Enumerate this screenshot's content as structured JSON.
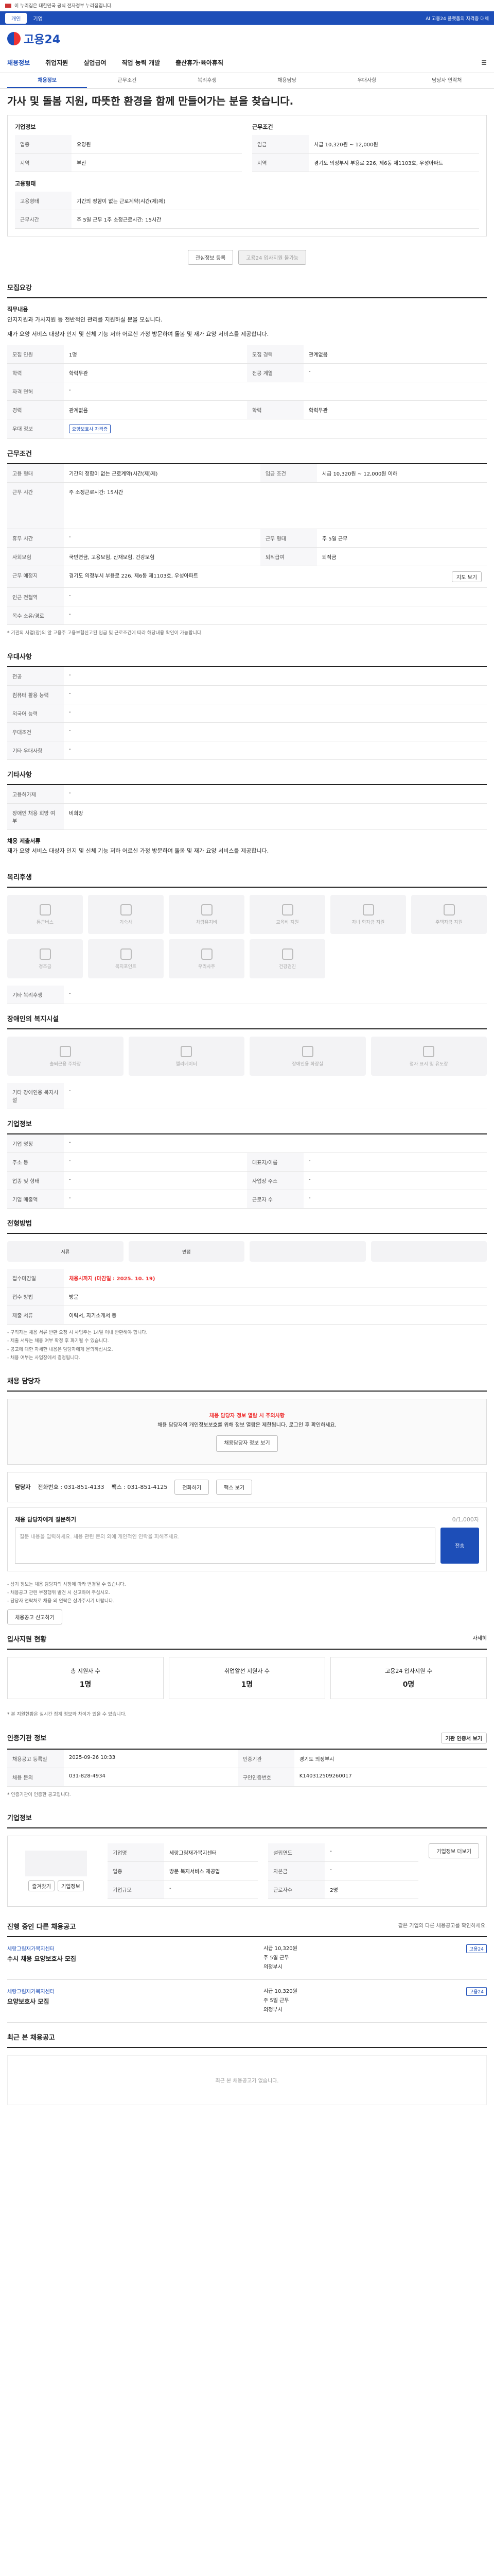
{
  "topbar": {
    "notice": "이 누리집은 대한민국 공식 전자정부 누리집입니다."
  },
  "subbar": {
    "tabs": [
      "개인",
      "기업"
    ],
    "right": "AI 고용24 플랫폼의 자격증 대체"
  },
  "header": {
    "logo_text": "고용24"
  },
  "gnb": {
    "items": [
      "채용정보",
      "취업지원",
      "실업급여",
      "직업 능력 개발",
      "출산휴가·육아휴직"
    ],
    "right": "☰"
  },
  "subtabs": [
    "채용정보",
    "근무조건",
    "복리후생",
    "채용담당",
    "우대사항",
    "담당자 연락처"
  ],
  "job": {
    "banner_title": "가사 및 돌봄 지원, 따뜻한 환경을 함께 만들어가는 분을 찾습니다.",
    "company_label": "기업정보",
    "salary_label": "근무조건",
    "rows_left": [
      {
        "k": "업종",
        "v": "요양원"
      },
      {
        "k": "지역",
        "v": "부산"
      }
    ],
    "rows_right": [
      {
        "k": "임금",
        "v": "시급 10,320원 ~ 12,000원"
      },
      {
        "k": "지역",
        "v": "경기도 의정부시 부용로 226, 제6동 제1103호, 우성아파트"
      }
    ],
    "hire_label": "고용형태",
    "hire_rows": [
      {
        "k": "고용형태",
        "v": "기간의 정함이 없는 근로계약(시간(제)제)"
      },
      {
        "k": "근무시간",
        "v": "주 5일 근무 1주 소정근로시간: 15시간"
      }
    ],
    "btn_bookmark": "관심정보 등록",
    "btn_apply": "고용24 입사지원 불가능"
  },
  "recruit": {
    "title": "모집요강",
    "intro": "직무내용",
    "intro_text": "인지지원과 가사지원 등 전반적인 관리를 지원하실 분을 모십니다.",
    "detail_text": "재가 요양 서비스 대상자 인지 및 신체 기능 저하 어르신 가정 방문하여 돌봄 및 재가 요양 서비스를 제공합니다.",
    "rows": [
      {
        "k": "모집 인원",
        "v": "1명",
        "k2": "모집 경력",
        "v2": "관계없음"
      },
      {
        "k": "학력",
        "v": "학력무관",
        "k2": "전공 계열",
        "v2": "-"
      },
      {
        "k": "자격 면허",
        "v": "-",
        "k2": "",
        "v2": ""
      },
      {
        "k": "경력",
        "v": "관계없음",
        "k2": "학력",
        "v2": "학력무관"
      },
      {
        "k": "우대 정보",
        "v": "요양보호사 자격증",
        "k2": "",
        "v2": ""
      }
    ]
  },
  "conditions": {
    "title": "근무조건",
    "rows": [
      {
        "k": "고용 형태",
        "v": "기간의 정함이 없는 근로계약(시간(제)제)",
        "k2": "임금 조건",
        "v2": "시급 10,320원 ~ 12,000원 이하"
      },
      {
        "k": "근무 시간",
        "v": "주 소정근로시간: 15시간",
        "k2": "",
        "v2": ""
      },
      {
        "k": "휴무 시간",
        "v": "-",
        "k2": "근무 형태",
        "v2": "주 5일 근무"
      },
      {
        "k": "사회보험",
        "v": "국민연금, 고용보험, 산재보험, 건강보험",
        "k2": "퇴직급여",
        "v2": "퇴직금"
      },
      {
        "k": "근무 예정지",
        "v": "경기도 의정부시 부용로 226, 제6동 제1103호, 우성아파트",
        "k2": "",
        "v2": ""
      },
      {
        "k": "인근 전철역",
        "v": "-",
        "k2": "",
        "v2": ""
      },
      {
        "k": "목수 소유/경로",
        "v": "-",
        "k2": "",
        "v2": ""
      }
    ],
    "map_btn": "지도 보기",
    "footnote": "* 기관의 사업(장)의 앞 고용주 고용보험신고된 임금 및 근로조건에 따라 해당내용 확인이 가능합니다."
  },
  "preference": {
    "title": "우대사항",
    "rows": [
      {
        "k": "전공",
        "v": "-"
      },
      {
        "k": "컴퓨터 활용 능력",
        "v": "-"
      },
      {
        "k": "외국어 능력",
        "v": "-"
      },
      {
        "k": "우대조건",
        "v": "-"
      },
      {
        "k": "기타 우대사항",
        "v": "-"
      }
    ]
  },
  "etc": {
    "title": "기타사항",
    "rows": [
      {
        "k": "고용허가제",
        "v": "-"
      },
      {
        "k": "장애인 채용 희망 여부",
        "v": "비희망"
      }
    ],
    "extra_title": "채용 제출서류",
    "extra_text": "재가 요양 서비스 대상자 인지 및 신체 기능 저하 어르신 가정 방문하여 돌봄 및 재가 요양 서비스를 제공합니다."
  },
  "welfare": {
    "title": "복리후생",
    "items": [
      "통근버스",
      "기숙사",
      "차량유지비",
      "교육비 지원",
      "자녀 학자금 지원",
      "주택자금 지원",
      "경조금",
      "복지포인트",
      "우리사주",
      "건강검진"
    ],
    "other_label": "기타 복리후생",
    "other_value": "-"
  },
  "disabled": {
    "title": "장애인의 복지시설",
    "items": [
      "출퇴근용 주차장",
      "엘리베이터",
      "장애인용 화장실",
      "점자 표시 및 유도장"
    ],
    "other_label": "기타 장애인용 복지시설",
    "other_value": "-"
  },
  "company": {
    "title": "기업정보",
    "rows": [
      {
        "k": "기업 명칭",
        "v": "-",
        "k2": "",
        "v2": ""
      },
      {
        "k": "주소 등",
        "v": "-",
        "k2": "대표자/이름",
        "v2": "-"
      },
      {
        "k": "업종 및 형태",
        "v": "-",
        "k2": "사업장 주소",
        "v2": "-"
      },
      {
        "k": "기업 매출액",
        "v": "-",
        "k2": "근로자 수",
        "v2": "-"
      }
    ]
  },
  "process": {
    "title": "전형방법",
    "steps": [
      "서류",
      "면접",
      "",
      ""
    ],
    "rows": [
      {
        "k": "접수마감일",
        "v": "채용시까지 (마감일 : 2025. 10. 19)"
      },
      {
        "k": "접수 방법",
        "v": "방문"
      },
      {
        "k": "제출 서류",
        "v": "이력서, 자기소개서 등"
      }
    ],
    "notes": [
      "- 구직자는 채용 서류 반환 요청 시 사업주는 14일 이내 반환해야 합니다.",
      "- 제출 서류는 채용 여부 확정 후 파기될 수 있습니다.",
      "- 공고에 대한 자세한 내용은 담당자에게 문의하십시오.",
      "- 채용 여부는 사업장에서 결정됩니다."
    ]
  },
  "contact": {
    "title": "채용 담당자",
    "notice_title": "채용 담당자 정보 열람 시 주의사항",
    "notice_text": "채용 담당자의 개인정보보호를 위해 정보 열람은 제한됩니다. 로그인 후 확인하세요.",
    "reveal_btn": "채용담당자 정보 보기",
    "manager_label": "담당자",
    "manager_phone": "전화번호 : 031-851-4133",
    "manager_fax": "팩스 : 031-851-4125",
    "btn_call": "전화하기",
    "btn_fax": "팩스 보기",
    "inquiry_label": "채용 담당자에게 질문하기",
    "inquiry_placeholder": "질문 내용을 입력하세요. 채용 관련 문의 외에 개인적인 연락을 피해주세요.",
    "inquiry_count": "0/1,000자",
    "submit_btn": "전송",
    "notes": [
      "- 상기 정보는 채용 담당자의 사정에 따라 변경될 수 있습니다.",
      "- 채용공고 관련 부정행위 발견 시 신고하여 주십시오.",
      "- 담당자 연락처로 채용 외 연락은 삼가주시기 바랍니다."
    ],
    "report_btn": "채용공고 신고하기"
  },
  "apply_stats": {
    "title": "입사지원 현황",
    "link": "자세히",
    "items": [
      {
        "label": "총 지원자 수",
        "value": "1명"
      },
      {
        "label": "취업알선 지원자 수",
        "value": "1명"
      },
      {
        "label": "고용24 입사지원 수",
        "value": "0명"
      }
    ],
    "note": "* 본 지원현황은 실시간 집계 정보와 차이가 있을 수 있습니다."
  },
  "cert": {
    "title": "인증기관 정보",
    "btn": "기관 인증서 보기",
    "rows": [
      {
        "k": "채용공고 등록일",
        "v": "2025-09-26 10:33",
        "k2": "인증기관",
        "v2": "경기도 의정부시"
      },
      {
        "k": "채용 문의",
        "v": "031-828-4934",
        "k2": "구인인증번호",
        "v2": "K140312509260017"
      }
    ],
    "note": "* 인증기관이 인증한 공고입니다."
  },
  "corp": {
    "title": "기업정보",
    "btns": [
      "즐겨찾기",
      "기업정보"
    ],
    "rows": [
      {
        "k": "기업명",
        "v": "세랑그림재가복지센터"
      },
      {
        "k": "업종",
        "v": "방문 복지서비스 제공업"
      },
      {
        "k": "기업규모",
        "v": "-"
      }
    ],
    "rows2": [
      {
        "k": "설립연도",
        "v": "-"
      },
      {
        "k": "자본금",
        "v": "-"
      },
      {
        "k": "근로자수",
        "v": "2명"
      }
    ],
    "more_btn": "기업정보 더보기"
  },
  "others": {
    "title": "진행 중인 다른 채용공고",
    "subtitle": "같은 기업의 다른 채용공고를 확인하세요.",
    "jobs": [
      {
        "co": "세랑그림재가복지센터",
        "title": "수시 채용 요양보호사 모집",
        "wage": "시급 10,320원",
        "type": "주 5일 근무",
        "place": "의정부시",
        "badge": "고용24"
      },
      {
        "co": "세랑그림재가복지센터",
        "title": "요양보호사 모집",
        "wage": "시급 10,320원",
        "type": "주 5일 근무",
        "place": "의정부시",
        "badge": "고용24"
      }
    ]
  },
  "recent": {
    "title": "최근 본 채용공고",
    "empty": "최근 본 채용공고가 없습니다."
  },
  "colors": {
    "primary": "#1d4eb8",
    "danger": "#e33"
  }
}
